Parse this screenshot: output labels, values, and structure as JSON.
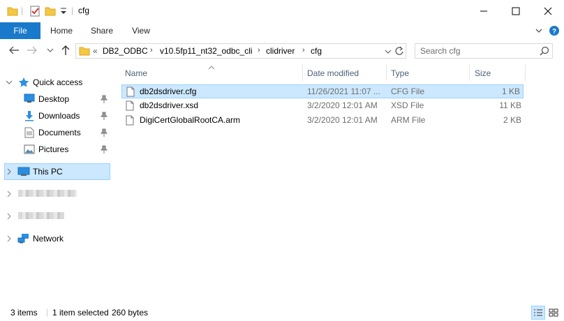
{
  "window": {
    "title": "cfg"
  },
  "ribbon": {
    "tabs": [
      "File",
      "Home",
      "Share",
      "View"
    ]
  },
  "address": {
    "overflow": "«",
    "crumbs": [
      "DB2_ODBC",
      "v10.5fp11_nt32_odbc_cli",
      "clidriver",
      "cfg"
    ]
  },
  "search": {
    "placeholder": "Search cfg"
  },
  "nav": {
    "quick_access": "Quick access",
    "quick_items": [
      "Desktop",
      "Downloads",
      "Documents",
      "Pictures"
    ],
    "this_pc": "This PC",
    "network": "Network"
  },
  "columns": {
    "name": "Name",
    "date": "Date modified",
    "type": "Type",
    "size": "Size"
  },
  "files": [
    {
      "name": "db2dsdriver.cfg",
      "date": "11/26/2021 11:07 ...",
      "type": "CFG File",
      "size": "1 KB"
    },
    {
      "name": "db2dsdriver.xsd",
      "date": "3/2/2020 12:01 AM",
      "type": "XSD File",
      "size": "11 KB"
    },
    {
      "name": "DigiCertGlobalRootCA.arm",
      "date": "3/2/2020 12:01 AM",
      "type": "ARM File",
      "size": "2 KB"
    }
  ],
  "status": {
    "items": "3 items",
    "selected": "1 item selected",
    "bytes": "260 bytes"
  },
  "colors": {
    "accent": "#1979ca",
    "selection": "#cce8ff",
    "selection_border": "#99d1ff"
  }
}
